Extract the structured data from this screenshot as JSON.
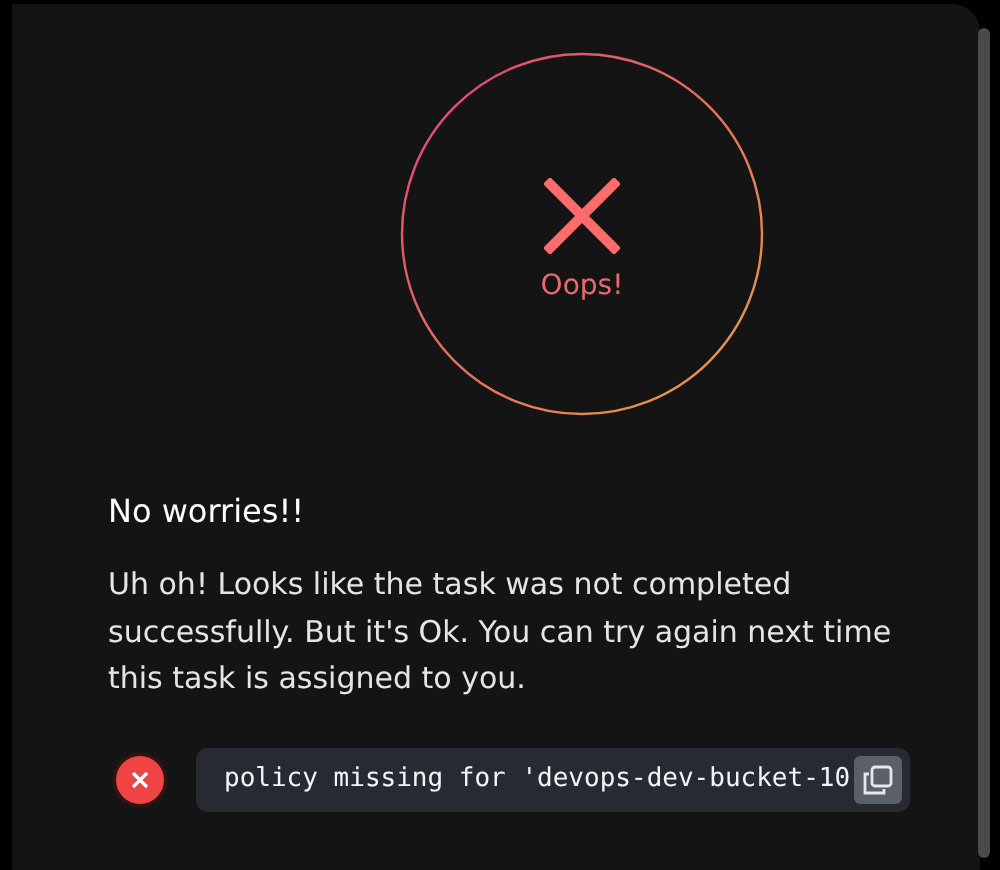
{
  "status": {
    "kind": "failure",
    "label": "Oops!"
  },
  "heading": "No worries!!",
  "message": "Uh oh! Looks like the task was not completed successfully. But it's Ok. You can try again next time this task is assigned to you.",
  "errors": [
    {
      "kind": "error",
      "text": "policy missing for 'devops-dev-bucket-10"
    }
  ]
}
